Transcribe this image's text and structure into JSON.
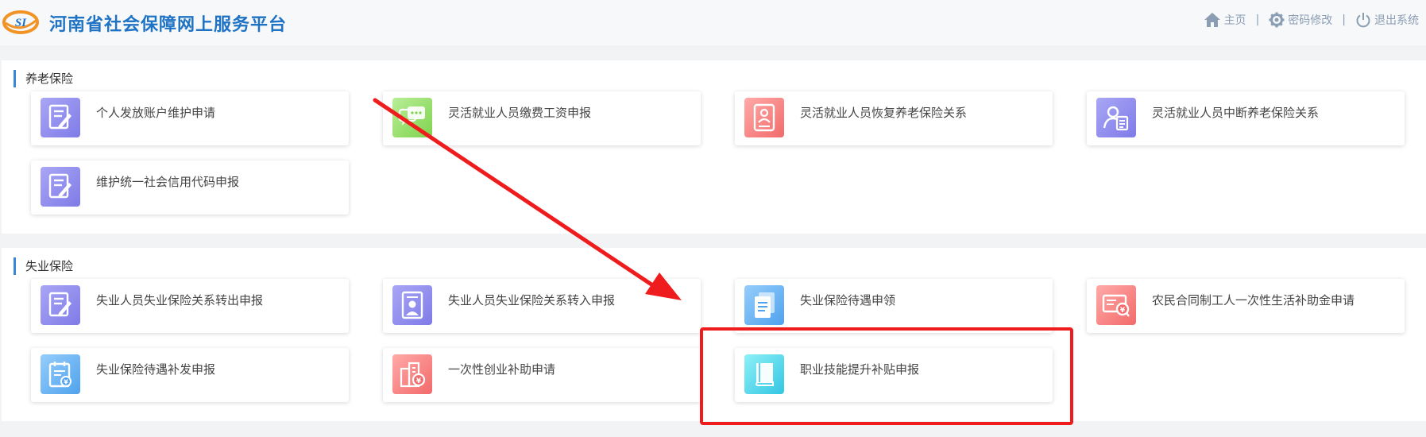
{
  "header": {
    "brand": "河南省社会保障网上服务平台",
    "logo_text": "SI",
    "nav": {
      "home": "主页",
      "password": "密码修改",
      "logout": "退出系统"
    }
  },
  "sections": [
    {
      "title": "养老保险",
      "items": [
        {
          "label": "个人发放账户维护申请",
          "icon": "edit-document-icon"
        },
        {
          "label": "灵活就业人员缴费工资申报",
          "icon": "chat-icon"
        },
        {
          "label": "灵活就业人员恢复养老保险关系",
          "icon": "id-document-icon"
        },
        {
          "label": "灵活就业人员中断养老保险关系",
          "icon": "user-list-icon"
        },
        {
          "label": "维护统一社会信用代码申报",
          "icon": "edit-document-icon"
        }
      ]
    },
    {
      "title": "失业保险",
      "items": [
        {
          "label": "失业人员失业保险关系转出申报",
          "icon": "edit-document-icon"
        },
        {
          "label": "失业人员失业保险关系转入申报",
          "icon": "person-card-icon"
        },
        {
          "label": "失业保险待遇申领",
          "icon": "document-icon"
        },
        {
          "label": "农民合同制工人一次性生活补助金申请",
          "icon": "money-search-icon"
        },
        {
          "label": "失业保险待遇补发申报",
          "icon": "calendar-money-icon"
        },
        {
          "label": "一次性创业补助申请",
          "icon": "building-money-icon"
        },
        {
          "label": "职业技能提升补贴申报",
          "icon": "book-icon"
        }
      ]
    }
  ],
  "colors": {
    "brand": "#1f73c4",
    "accent_bar": "#3a86d8",
    "annotation": "#ee1c1c"
  }
}
